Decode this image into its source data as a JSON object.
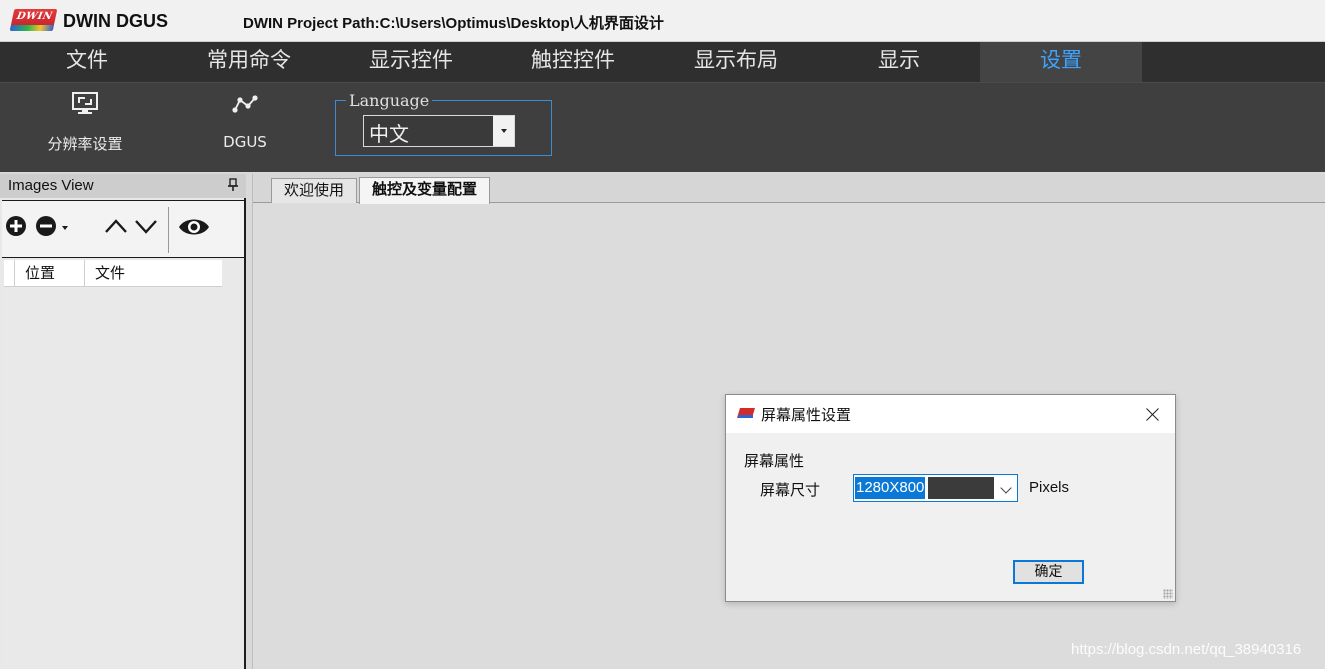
{
  "titlebar": {
    "logo_text": "DWIN",
    "app_name": "DWIN DGUS",
    "project_path": "DWIN Project Path:C:\\Users\\Optimus\\Desktop\\人机界面设计"
  },
  "menu": {
    "items": [
      {
        "label": "文件"
      },
      {
        "label": "常用命令"
      },
      {
        "label": "显示控件"
      },
      {
        "label": "触控控件"
      },
      {
        "label": "显示布局"
      },
      {
        "label": "显示"
      },
      {
        "label": "设置",
        "active": true
      }
    ],
    "active_color": "#3ea2ff"
  },
  "ribbon": {
    "resolution_label": "分辨率设置",
    "resolution_icon": "monitor-icon",
    "dgus_label": "DGUS",
    "dgus_icon": "node-graph-icon",
    "language_legend": "Language",
    "language_value": "中文"
  },
  "images_view": {
    "title": "Images View",
    "toolbar_icons": [
      "add-icon",
      "remove-icon",
      "chevron-up-icon",
      "chevron-down-icon",
      "eye-icon"
    ],
    "columns": [
      "位置",
      "文件"
    ]
  },
  "tabs": [
    {
      "label": "欢迎使用",
      "active": false
    },
    {
      "label": "触控及变量配置",
      "active": true
    }
  ],
  "dialog": {
    "title": "屏幕属性设置",
    "group_label": "屏幕属性",
    "size_label": "屏幕尺寸",
    "size_value": "1280X800",
    "unit": "Pixels",
    "ok_label": "确定",
    "accent": "#0a78d7"
  },
  "watermark": "https://blog.csdn.net/qq_38940316"
}
